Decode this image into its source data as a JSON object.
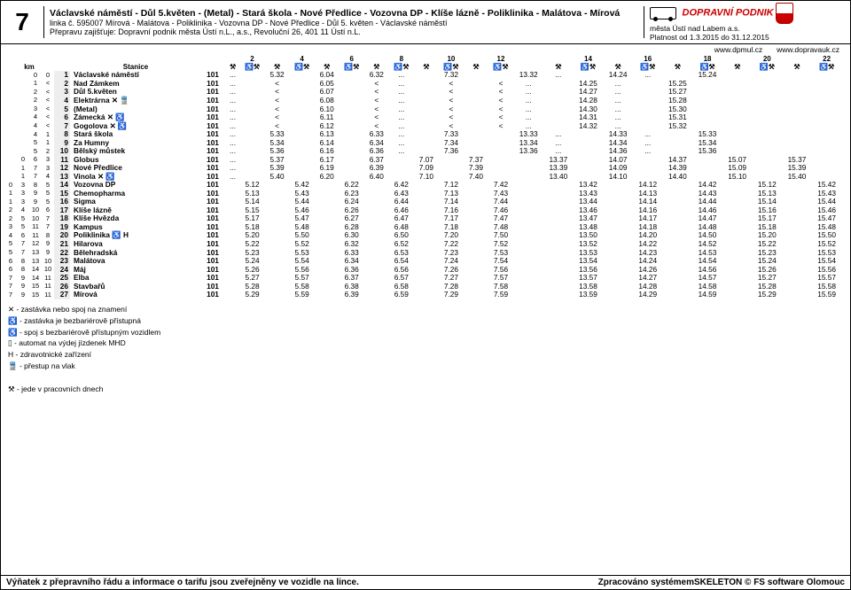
{
  "line_number": "7",
  "route_fwd": "Václavské náměstí - Důl 5.květen - (Metal) - Stará škola - Nové Předlice - Vozovna DP - Klíše lázně - Poliklinika - Malátova - Mírová",
  "route_code": "linka č. 595007 Mírová - Malátova - Poliklinika - Vozovna DP - Nové Předlice - Důl 5. květen - Václavské náměstí",
  "carrier": "Přepravu zajišťuje: Dopravní podnik města Ústí n.L., a.s., Revoluční 26, 401 11 Ústí n.L.",
  "brand": "DOPRAVNÍ PODNIK",
  "city": "města Ústí nad Labem a.s.",
  "validity": "Platnost od 1.3.2015 do 31.12.2015",
  "url_left": "www.dpmul.cz",
  "url_right": "www.dopravauk.cz",
  "label_km": "km",
  "label_stn": "Stanice",
  "col_nums": [
    "",
    "2",
    "",
    "4",
    "",
    "6",
    "",
    "8",
    "",
    "10",
    "",
    "12",
    "",
    "",
    "14",
    "",
    "16",
    "",
    "18",
    "",
    "20",
    "",
    "22",
    ""
  ],
  "rows": [
    {
      "km": [
        "",
        "0",
        "0"
      ],
      "i": "1",
      "stn": "Václavské náměstí",
      "code": "101",
      "t": [
        "...",
        "",
        "5.32",
        "",
        "6.04",
        "",
        "6.32",
        "...",
        "",
        "7.32",
        "",
        "",
        "13.32",
        "...",
        "",
        "14.24",
        "...",
        "",
        "15.24"
      ]
    },
    {
      "km": [
        "",
        "1",
        "<"
      ],
      "i": "2",
      "stn": "Nad Zámkem",
      "code": "101",
      "t": [
        "...",
        "",
        "<",
        "",
        "6.05",
        "",
        "<",
        "...",
        "",
        "<",
        "",
        "<",
        "...",
        "",
        "14.25",
        "...",
        "",
        "15.25"
      ]
    },
    {
      "km": [
        "",
        "2",
        "<"
      ],
      "i": "3",
      "stn": "Důl 5.květen",
      "code": "101",
      "t": [
        "...",
        "",
        "<",
        "",
        "6.07",
        "",
        "<",
        "...",
        "",
        "<",
        "",
        "<",
        "...",
        "",
        "14.27",
        "...",
        "",
        "15.27"
      ]
    },
    {
      "km": [
        "",
        "2",
        "<"
      ],
      "i": "4",
      "stn": "Elektrárna ✕ 🚆",
      "code": "101",
      "t": [
        "...",
        "",
        "<",
        "",
        "6.08",
        "",
        "<",
        "...",
        "",
        "<",
        "",
        "<",
        "...",
        "",
        "14.28",
        "...",
        "",
        "15.28"
      ]
    },
    {
      "km": [
        "",
        "3",
        "<"
      ],
      "i": "5",
      "stn": "(Metal)",
      "code": "101",
      "t": [
        "...",
        "",
        "<",
        "",
        "6.10",
        "",
        "<",
        "...",
        "",
        "<",
        "",
        "<",
        "...",
        "",
        "14.30",
        "...",
        "",
        "15.30"
      ]
    },
    {
      "km": [
        "",
        "4",
        "<"
      ],
      "i": "6",
      "stn": "Zámecká ✕ ♿",
      "code": "101",
      "t": [
        "...",
        "",
        "<",
        "",
        "6.11",
        "",
        "<",
        "...",
        "",
        "<",
        "",
        "<",
        "...",
        "",
        "14.31",
        "...",
        "",
        "15.31"
      ]
    },
    {
      "km": [
        "",
        "4",
        "<"
      ],
      "i": "7",
      "stn": "Gogolova ✕ ♿",
      "code": "101",
      "t": [
        "...",
        "",
        "<",
        "",
        "6.12",
        "",
        "<",
        "...",
        "",
        "<",
        "",
        "<",
        "...",
        "",
        "14.32",
        "...",
        "",
        "15.32"
      ]
    },
    {
      "km": [
        "",
        "4",
        "1"
      ],
      "i": "8",
      "stn": "Stará škola",
      "code": "101",
      "t": [
        "...",
        "",
        "5.33",
        "",
        "6.13",
        "",
        "6.33",
        "...",
        "",
        "7.33",
        "",
        "",
        "13.33",
        "...",
        "",
        "14.33",
        "...",
        "",
        "15.33"
      ]
    },
    {
      "km": [
        "",
        "5",
        "1"
      ],
      "i": "9",
      "stn": "Za Humny",
      "code": "101",
      "t": [
        "...",
        "",
        "5.34",
        "",
        "6.14",
        "",
        "6.34",
        "...",
        "",
        "7.34",
        "",
        "",
        "13.34",
        "...",
        "",
        "14.34",
        "...",
        "",
        "15.34"
      ]
    },
    {
      "km": [
        "",
        "5",
        "2"
      ],
      "i": "10",
      "stn": "Bělský můstek",
      "code": "101",
      "t": [
        "...",
        "",
        "5.36",
        "",
        "6.16",
        "",
        "6.36",
        "...",
        "",
        "7.36",
        "",
        "",
        "13.36",
        "...",
        "",
        "14.36",
        "...",
        "",
        "15.36"
      ]
    },
    {
      "km": [
        "0",
        "6",
        "3"
      ],
      "i": "11",
      "stn": "Globus",
      "code": "101",
      "t": [
        "...",
        "",
        "5.37",
        "",
        "6.17",
        "",
        "6.37",
        "",
        "7.07",
        "",
        "7.37",
        "",
        "",
        "13.37",
        "",
        "14.07",
        "",
        "14.37",
        "",
        "15.07",
        "",
        "15.37"
      ]
    },
    {
      "km": [
        "1",
        "7",
        "3"
      ],
      "i": "12",
      "stn": "Nové Předlice",
      "code": "101",
      "t": [
        "...",
        "",
        "5.39",
        "",
        "6.19",
        "",
        "6.39",
        "",
        "7.09",
        "",
        "7.39",
        "",
        "",
        "13.39",
        "",
        "14.09",
        "",
        "14.39",
        "",
        "15.09",
        "",
        "15.39"
      ]
    },
    {
      "km": [
        "1",
        "7",
        "4"
      ],
      "i": "13",
      "stn": "Vinola ✕ ♿",
      "code": "101",
      "t": [
        "...",
        "",
        "5.40",
        "",
        "6.20",
        "",
        "6.40",
        "",
        "7.10",
        "",
        "7.40",
        "",
        "",
        "13.40",
        "",
        "14.10",
        "",
        "14.40",
        "",
        "15.10",
        "",
        "15.40"
      ]
    },
    {
      "km": [
        "0",
        "3",
        "8",
        "5"
      ],
      "i": "14",
      "stn": "Vozovna DP",
      "code": "101",
      "t": [
        "",
        "5.12",
        "",
        "5.42",
        "",
        "6.22",
        "",
        "6.42",
        "",
        "7.12",
        "",
        "7.42",
        "",
        "",
        "13.42",
        "",
        "14.12",
        "",
        "14.42",
        "",
        "15.12",
        "",
        "15.42"
      ]
    },
    {
      "km": [
        "1",
        "3",
        "9",
        "5"
      ],
      "i": "15",
      "stn": "Chemopharma",
      "code": "101",
      "t": [
        "",
        "5.13",
        "",
        "5.43",
        "",
        "6.23",
        "",
        "6.43",
        "",
        "7.13",
        "",
        "7.43",
        "",
        "",
        "13.43",
        "",
        "14.13",
        "",
        "14.43",
        "",
        "15.13",
        "",
        "15.43"
      ]
    },
    {
      "km": [
        "1",
        "3",
        "9",
        "5"
      ],
      "i": "16",
      "stn": "Sigma",
      "code": "101",
      "t": [
        "",
        "5.14",
        "",
        "5.44",
        "",
        "6.24",
        "",
        "6.44",
        "",
        "7.14",
        "",
        "7.44",
        "",
        "",
        "13.44",
        "",
        "14.14",
        "",
        "14.44",
        "",
        "15.14",
        "",
        "15.44"
      ]
    },
    {
      "km": [
        "2",
        "4",
        "10",
        "6"
      ],
      "i": "17",
      "stn": "Klíše lázně",
      "code": "101",
      "t": [
        "",
        "5.15",
        "",
        "5.46",
        "",
        "6.26",
        "",
        "6.46",
        "",
        "7.16",
        "",
        "7.46",
        "",
        "",
        "13.46",
        "",
        "14.16",
        "",
        "14.46",
        "",
        "15.16",
        "",
        "15.46"
      ]
    },
    {
      "km": [
        "2",
        "5",
        "10",
        "7"
      ],
      "i": "18",
      "stn": "Klíše Hvězda",
      "code": "101",
      "t": [
        "",
        "5.17",
        "",
        "5.47",
        "",
        "6.27",
        "",
        "6.47",
        "",
        "7.17",
        "",
        "7.47",
        "",
        "",
        "13.47",
        "",
        "14.17",
        "",
        "14.47",
        "",
        "15.17",
        "",
        "15.47"
      ]
    },
    {
      "km": [
        "3",
        "5",
        "11",
        "7"
      ],
      "i": "19",
      "stn": "Kampus",
      "code": "101",
      "t": [
        "",
        "5.18",
        "",
        "5.48",
        "",
        "6.28",
        "",
        "6.48",
        "",
        "7.18",
        "",
        "7.48",
        "",
        "",
        "13.48",
        "",
        "14.18",
        "",
        "14.48",
        "",
        "15.18",
        "",
        "15.48"
      ]
    },
    {
      "km": [
        "4",
        "6",
        "11",
        "8"
      ],
      "i": "20",
      "stn": "Poliklinika ♿ H",
      "code": "101",
      "t": [
        "",
        "5.20",
        "",
        "5.50",
        "",
        "6.30",
        "",
        "6.50",
        "",
        "7.20",
        "",
        "7.50",
        "",
        "",
        "13.50",
        "",
        "14.20",
        "",
        "14.50",
        "",
        "15.20",
        "",
        "15.50"
      ]
    },
    {
      "km": [
        "5",
        "7",
        "12",
        "9"
      ],
      "i": "21",
      "stn": "Hilarova",
      "code": "101",
      "t": [
        "",
        "5.22",
        "",
        "5.52",
        "",
        "6.32",
        "",
        "6.52",
        "",
        "7.22",
        "",
        "7.52",
        "",
        "",
        "13.52",
        "",
        "14.22",
        "",
        "14.52",
        "",
        "15.22",
        "",
        "15.52"
      ]
    },
    {
      "km": [
        "5",
        "7",
        "13",
        "9"
      ],
      "i": "22",
      "stn": "Bělehradská",
      "code": "101",
      "t": [
        "",
        "5.23",
        "",
        "5.53",
        "",
        "6.33",
        "",
        "6.53",
        "",
        "7.23",
        "",
        "7.53",
        "",
        "",
        "13.53",
        "",
        "14.23",
        "",
        "14.53",
        "",
        "15.23",
        "",
        "15.53"
      ]
    },
    {
      "km": [
        "6",
        "8",
        "13",
        "10"
      ],
      "i": "23",
      "stn": "Malátova",
      "code": "101",
      "t": [
        "",
        "5.24",
        "",
        "5.54",
        "",
        "6.34",
        "",
        "6.54",
        "",
        "7.24",
        "",
        "7.54",
        "",
        "",
        "13.54",
        "",
        "14.24",
        "",
        "14.54",
        "",
        "15.24",
        "",
        "15.54"
      ]
    },
    {
      "km": [
        "6",
        "8",
        "14",
        "10"
      ],
      "i": "24",
      "stn": "Máj",
      "code": "101",
      "t": [
        "",
        "5.26",
        "",
        "5.56",
        "",
        "6.36",
        "",
        "6.56",
        "",
        "7.26",
        "",
        "7.56",
        "",
        "",
        "13.56",
        "",
        "14.26",
        "",
        "14.56",
        "",
        "15.26",
        "",
        "15.56"
      ]
    },
    {
      "km": [
        "7",
        "9",
        "14",
        "11"
      ],
      "i": "25",
      "stn": "Elba",
      "code": "101",
      "t": [
        "",
        "5.27",
        "",
        "5.57",
        "",
        "6.37",
        "",
        "6.57",
        "",
        "7.27",
        "",
        "7.57",
        "",
        "",
        "13.57",
        "",
        "14.27",
        "",
        "14.57",
        "",
        "15.27",
        "",
        "15.57"
      ]
    },
    {
      "km": [
        "7",
        "9",
        "15",
        "11"
      ],
      "i": "26",
      "stn": "Stavbařů",
      "code": "101",
      "t": [
        "",
        "5.28",
        "",
        "5.58",
        "",
        "6.38",
        "",
        "6.58",
        "",
        "7.28",
        "",
        "7.58",
        "",
        "",
        "13.58",
        "",
        "14.28",
        "",
        "14.58",
        "",
        "15.28",
        "",
        "15.58"
      ]
    },
    {
      "km": [
        "7",
        "9",
        "15",
        "11"
      ],
      "i": "27",
      "stn": "Mírová",
      "code": "101",
      "t": [
        "",
        "5.29",
        "",
        "5.59",
        "",
        "6.39",
        "",
        "6.59",
        "",
        "7.29",
        "",
        "7.59",
        "",
        "",
        "13.59",
        "",
        "14.29",
        "",
        "14.59",
        "",
        "15.29",
        "",
        "15.59"
      ]
    }
  ],
  "legend": [
    "✕ - zastávka nebo spoj na znamení",
    "♿ - zastávka je bezbariérově přístupná",
    "♿ - spoj s bezbariérově přístupným vozidlem",
    "▯ - automat na výdej jízdenek MHD",
    "H - zdravotnické zařízení",
    "🚆 - přestup na vlak",
    "",
    "⚒ - jede v pracovních dnech"
  ],
  "footer_left": "Výňatek z přepravního řádu a informace o tarifu jsou zveřejněny ve vozidle na lince.",
  "footer_right": "Zpracováno systémemSKELETON © FS software Olomouc"
}
